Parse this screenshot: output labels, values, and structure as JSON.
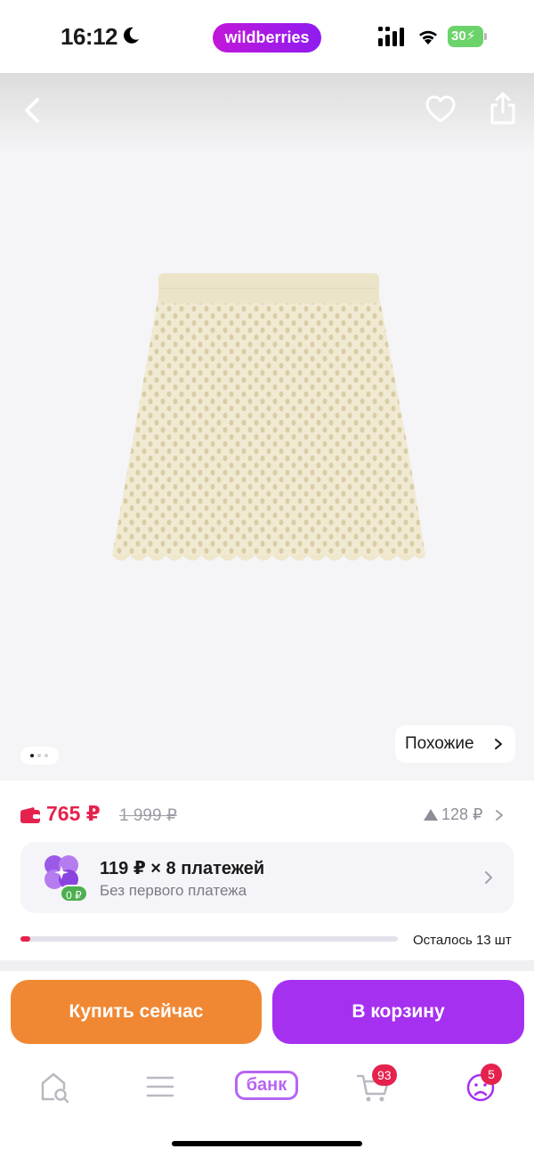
{
  "status_bar": {
    "time": "16:12",
    "brand": "wildberries",
    "battery": "30"
  },
  "gallery": {
    "similar_label": "Похожие",
    "current_slide": 1,
    "total_slides": 3,
    "icons": [
      "back-icon",
      "heart-icon",
      "share-icon"
    ]
  },
  "price": {
    "current": "765 ₽",
    "old": "1 999 ₽",
    "trend": "128 ₽"
  },
  "installment": {
    "title": "119 ₽ × 8 платежей",
    "subtitle": "Без первого платежа",
    "badge": "0 ₽"
  },
  "stock": {
    "label": "Осталось 13 шт",
    "fill_fraction": 0.025
  },
  "actions": {
    "buy_now": "Купить сейчас",
    "add_to_cart": "В корзину"
  },
  "bottom_nav": {
    "bank_label": "банк",
    "cart_badge": "93",
    "profile_badge": "5"
  },
  "colors": {
    "brand": "#a630f0",
    "price_red": "#e5224d",
    "buy_orange": "#f08833",
    "success_green": "#4caf50"
  }
}
